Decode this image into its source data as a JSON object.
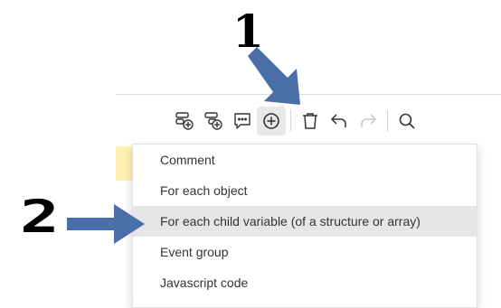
{
  "annotations": {
    "step1": "1",
    "step2": "2",
    "arrow_color": "#4a6fa8"
  },
  "toolbar": {
    "buttons": [
      {
        "icon": "add-event-icon"
      },
      {
        "icon": "add-subevent-icon"
      },
      {
        "icon": "add-comment-icon"
      },
      {
        "icon": "add-other-icon",
        "active": true
      },
      {
        "icon": "delete-icon"
      },
      {
        "icon": "undo-icon"
      },
      {
        "icon": "redo-icon",
        "disabled": true
      },
      {
        "icon": "search-icon"
      }
    ]
  },
  "menu": {
    "items": [
      {
        "label": "Comment"
      },
      {
        "label": "For each object"
      },
      {
        "label": "For each child variable (of a structure or array)",
        "highlighted": true
      },
      {
        "label": "Event group"
      },
      {
        "label": "Javascript code"
      }
    ]
  },
  "colors": {
    "highlight": "#e6e6e6",
    "yellow_strip": "#fff1b0"
  }
}
